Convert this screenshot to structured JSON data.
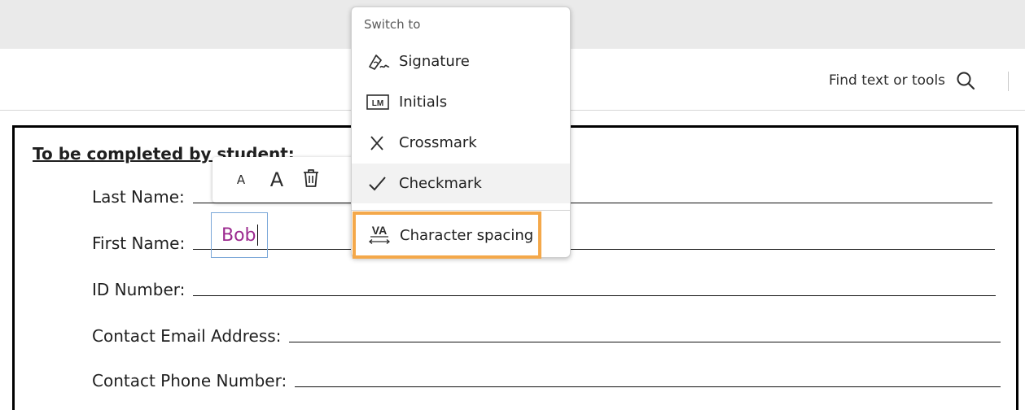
{
  "toolbar": {
    "find_label": "Find text or tools"
  },
  "form": {
    "heading": "To be completed by student:",
    "fields": [
      {
        "label": "Last Name:"
      },
      {
        "label": "First Name:",
        "value": "Bob"
      },
      {
        "label": "ID Number:"
      },
      {
        "label": "Contact Email Address:"
      },
      {
        "label": "Contact Phone Number:"
      }
    ]
  },
  "mini_toolbar": {
    "decrease_label": "A",
    "increase_label": "A"
  },
  "menu": {
    "title": "Switch to",
    "items": [
      {
        "label": "Signature",
        "icon": "signature-icon"
      },
      {
        "label": "Initials",
        "icon": "initials-icon",
        "icon_text": "LM"
      },
      {
        "label": "Crossmark",
        "icon": "crossmark-icon"
      },
      {
        "label": "Checkmark",
        "icon": "checkmark-icon"
      },
      {
        "label": "Character spacing",
        "icon": "character-spacing-icon",
        "icon_text": "VA"
      }
    ]
  },
  "colors": {
    "highlight": "#f4a84a",
    "filled_text": "#9c2b8f",
    "field_border": "#7aa7d8"
  }
}
